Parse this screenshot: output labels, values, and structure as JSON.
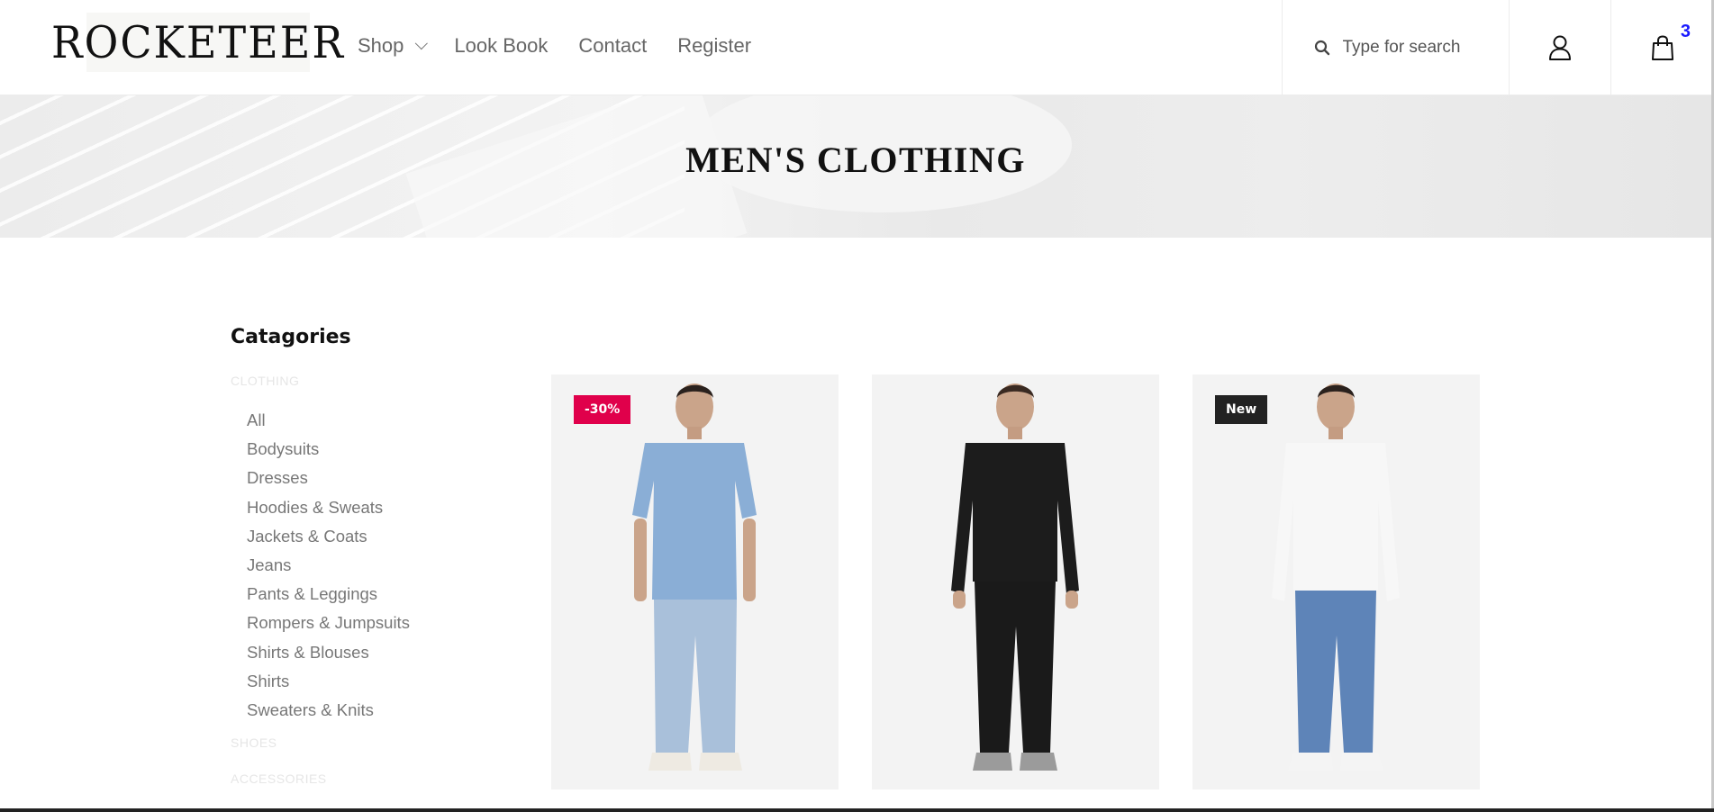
{
  "brand": {
    "logo_text": "ROCKETEER"
  },
  "nav": {
    "items": [
      {
        "label": "Shop",
        "has_dropdown": true
      },
      {
        "label": "Look Book"
      },
      {
        "label": "Contact"
      },
      {
        "label": "Register"
      }
    ]
  },
  "search": {
    "placeholder": "Type for search",
    "icon": "search-icon"
  },
  "account": {
    "icon": "user-icon"
  },
  "cart": {
    "icon": "shopping-bag-icon",
    "count": "3"
  },
  "banner": {
    "title": "MEN'S CLOTHING"
  },
  "sidebar": {
    "title": "Catagories",
    "groups": [
      {
        "label": "CLOTHING",
        "items": [
          "All",
          "Bodysuits",
          "Dresses",
          "Hoodies & Sweats",
          "Jackets & Coats",
          "Jeans",
          "Pants & Leggings",
          "Rompers & Jumpsuits",
          "Shirts & Blouses",
          "Shirts",
          "Sweaters & Knits"
        ]
      },
      {
        "label": "SHOES"
      },
      {
        "label": "ACCESSORIES"
      }
    ]
  },
  "products": [
    {
      "badge": "-30%",
      "badge_type": "sale",
      "shirt_color": "#8aaed6",
      "pants_color": "#a9c0da",
      "shoe_color": "#eeeae2"
    },
    {
      "badge": "",
      "badge_type": "none",
      "shirt_color": "#1c1c1c",
      "pants_color": "#1a1a1a",
      "shoe_color": "#9b9b9b"
    },
    {
      "badge": "New",
      "badge_type": "new",
      "shirt_color": "#f7f7f7",
      "pants_color": "#5e84b8",
      "shoe_color": "#f4f4f4"
    }
  ],
  "colors": {
    "sale_badge": "#e0004b",
    "new_badge": "#222222",
    "cart_count": "#1a1aff"
  }
}
